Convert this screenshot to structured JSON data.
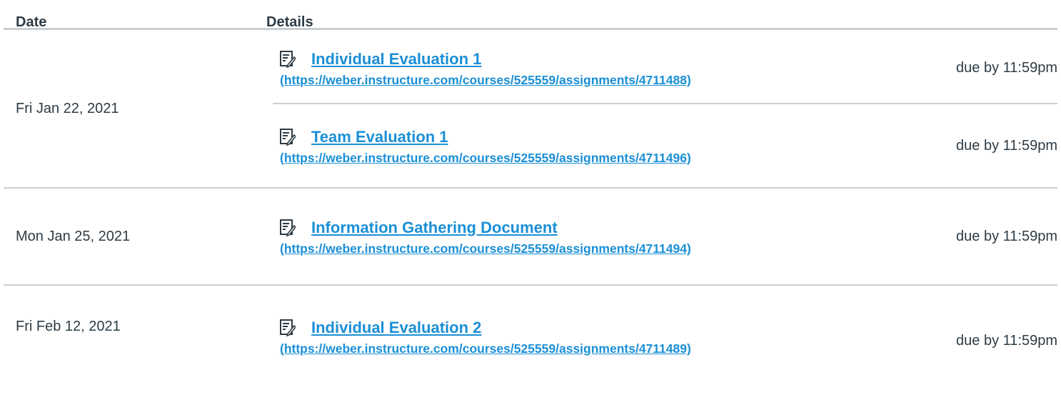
{
  "header": {
    "date_label": "Date",
    "details_label": "Details"
  },
  "groups": [
    {
      "date": "Fri Jan 22, 2021",
      "items": [
        {
          "title": "Individual Evaluation 1",
          "url": "(https://weber.instructure.com/courses/525559/assignments/4711488)",
          "due": "due by 11:59pm",
          "icon": "assignment-icon"
        },
        {
          "title": "Team Evaluation 1",
          "url": "(https://weber.instructure.com/courses/525559/assignments/4711496)",
          "due": "due by 11:59pm",
          "icon": "assignment-icon"
        }
      ]
    },
    {
      "date": "Mon Jan 25, 2021",
      "items": [
        {
          "title": "Information Gathering Document",
          "url": "(https://weber.instructure.com/courses/525559/assignments/4711494)",
          "due": "due by 11:59pm",
          "icon": "assignment-icon"
        }
      ]
    },
    {
      "date": "Fri Feb 12, 2021",
      "items": [
        {
          "title": "Individual Evaluation 2",
          "url": "(https://weber.instructure.com/courses/525559/assignments/4711489)",
          "due": "due by 11:59pm",
          "icon": "assignment-icon"
        }
      ]
    }
  ],
  "colors": {
    "link": "#1b8fd6",
    "text": "#2d3b45",
    "border": "#c7cdd1"
  }
}
